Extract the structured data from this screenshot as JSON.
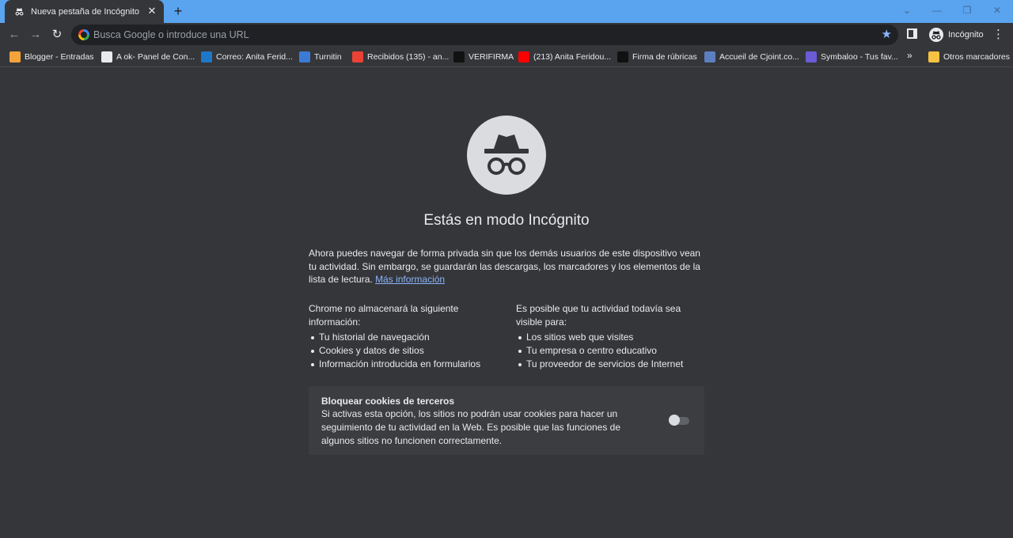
{
  "tab": {
    "title": "Nueva pestaña de Incógnito",
    "close_glyph": "✕"
  },
  "new_tab_glyph": "+",
  "window_controls": [
    "⌄",
    "—",
    "❐",
    "✕"
  ],
  "omnibox": {
    "placeholder": "Busca Google o introduce una URL"
  },
  "profile": {
    "label": "Incógnito"
  },
  "bookmarks": [
    {
      "label": "Blogger - Entradas",
      "icon": "blogger-icon",
      "color": "#f4a23a"
    },
    {
      "label": "A ok- Panel de Con...",
      "icon": "google-icon",
      "color": "#e8eaed"
    },
    {
      "label": "Correo: Anita Ferid...",
      "icon": "outlook-icon",
      "color": "#1e78c8"
    },
    {
      "label": "Turnitin",
      "icon": "turnitin-icon",
      "color": "#3b7bd5"
    },
    {
      "label": "Recibidos (135) - an...",
      "icon": "gmail-icon",
      "color": "#ea4335"
    },
    {
      "label": "VERIFIRMA",
      "icon": "verifirma-icon",
      "color": "#111111"
    },
    {
      "label": "(213) Anita Feridou...",
      "icon": "youtube-icon",
      "color": "#ff0000"
    },
    {
      "label": "Firma de rúbricas",
      "icon": "rubricas-icon",
      "color": "#111111"
    },
    {
      "label": "Accueil de Cjoint.co...",
      "icon": "cjoint-icon",
      "color": "#5c7fc0"
    },
    {
      "label": "Symbaloo - Tus fav...",
      "icon": "symbaloo-icon",
      "color": "#6b5bd6"
    }
  ],
  "bookmarks_more": "»",
  "other_bookmarks": {
    "label": "Otros marcadores",
    "icon": "folder-icon",
    "color": "#f5c242"
  },
  "content": {
    "title": "Estás en modo Incógnito",
    "intro": "Ahora puedes navegar de forma privada sin que los demás usuarios de este dispositivo vean tu actividad. Sin embargo, se guardarán las descargas, los marcadores y los elementos de la lista de lectura.",
    "learn_more": "Más información",
    "left_heading": "Chrome no almacenará la siguiente información:",
    "left_items": [
      "Tu historial de navegación",
      "Cookies y datos de sitios",
      "Información introducida en formularios"
    ],
    "right_heading": "Es posible que tu actividad todavía sea visible para:",
    "right_items": [
      "Los sitios web que visites",
      "Tu empresa o centro educativo",
      "Tu proveedor de servicios de Internet"
    ]
  },
  "cookies": {
    "title": "Bloquear cookies de terceros",
    "description": "Si activas esta opción, los sitios no podrán usar cookies para hacer un seguimiento de tu actividad en la Web. Es posible que las funciones de algunos sitios no funcionen correctamente.",
    "enabled": false
  }
}
